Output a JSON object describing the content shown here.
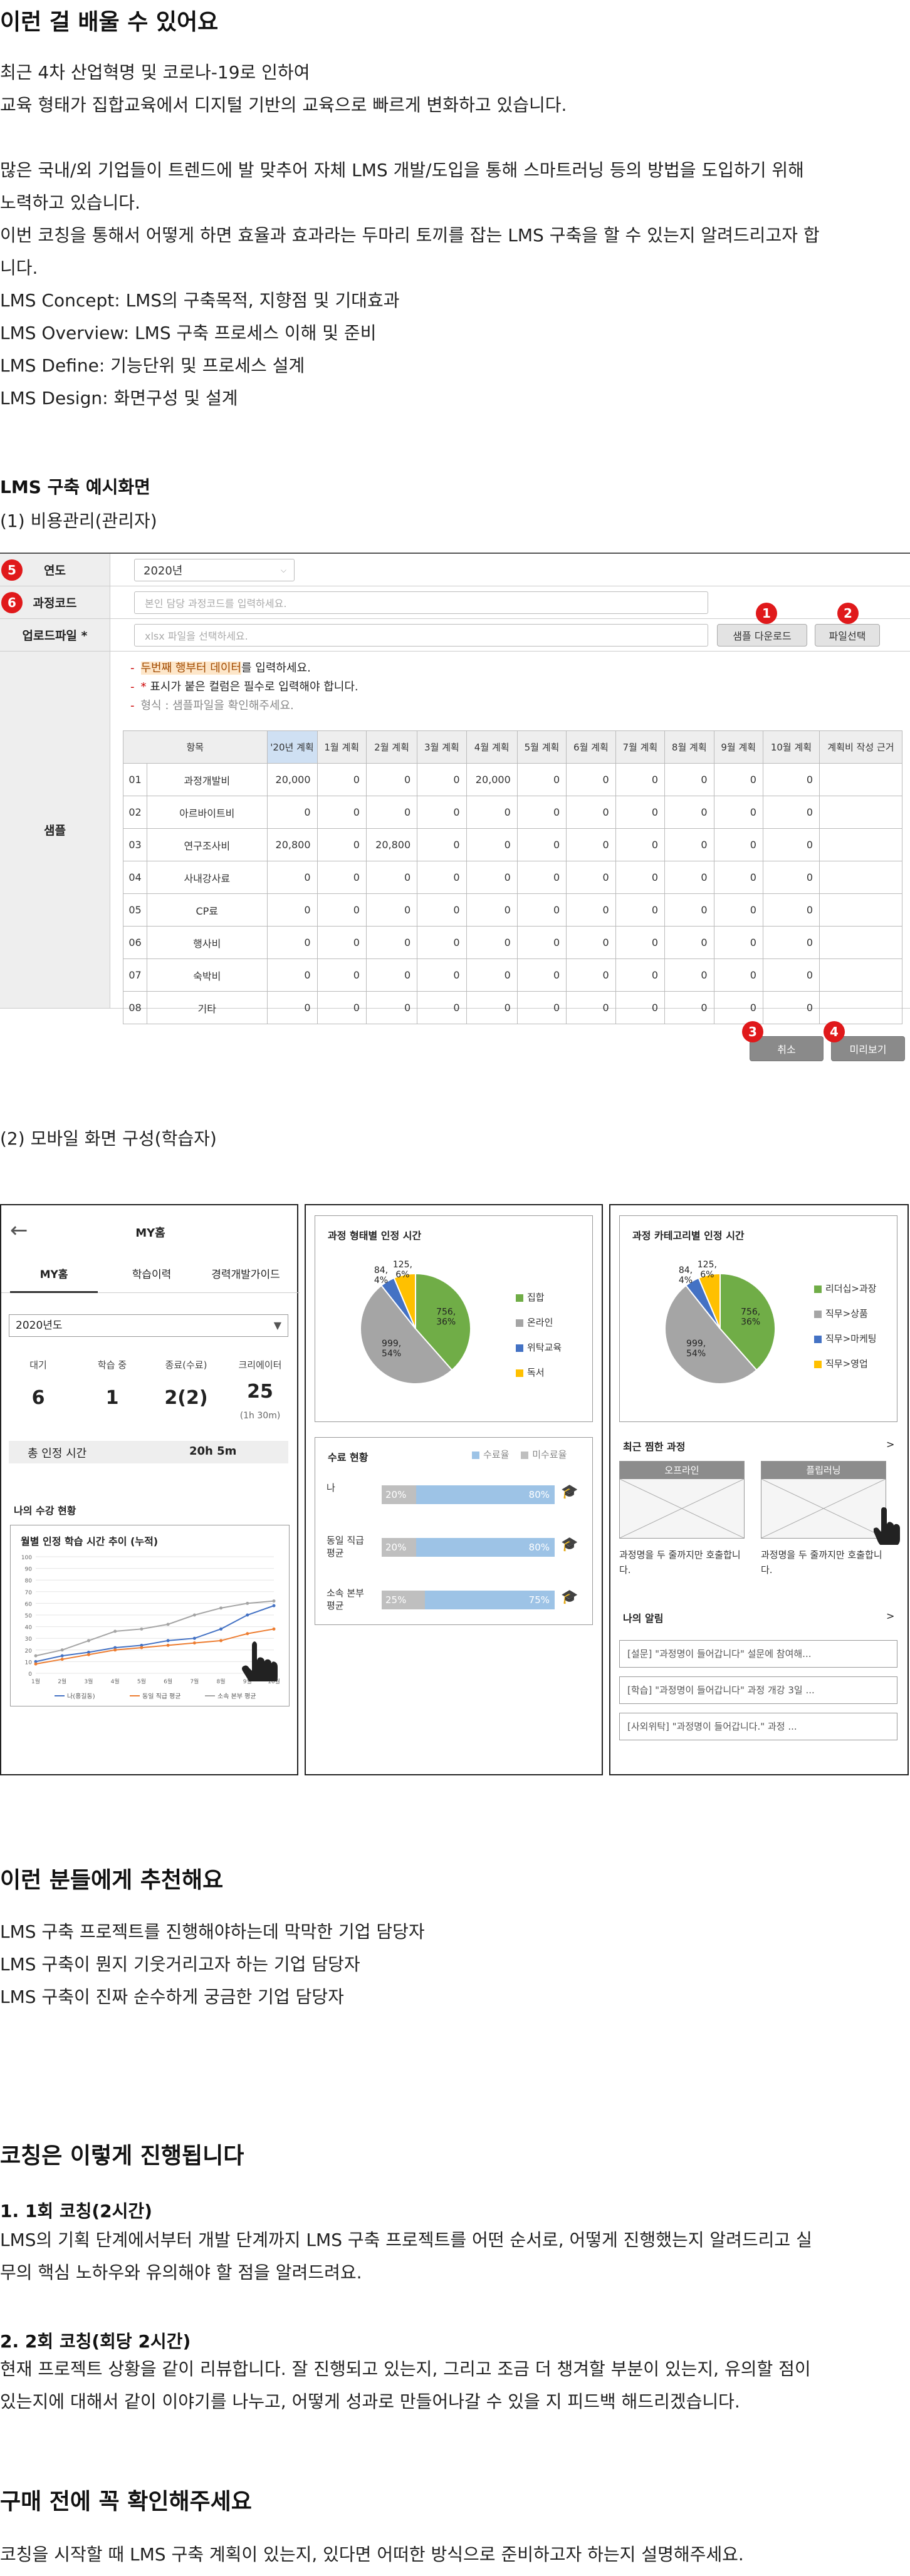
{
  "section1": {
    "title": "이런 걸 배울 수 있어요",
    "paragraphs": [
      "최근 4차 산업혁명 및 코로나-19로 인하여",
      "교육 형태가 집합교육에서 디지털 기반의 교육으로 빠르게 변화하고 있습니다.",
      "많은 국내/외 기업들이 트렌드에 발 맞추어 자체 LMS 개발/도입을 통해 스마트러닝 등의 방법을 도입하기 위해",
      "노력하고 있습니다.",
      "이번 코칭을 통해서 어떻게 하면 효율과 효과라는 두마리 토끼를 잡는 LMS 구축을 할 수 있는지 알려드리고자 합",
      "니다.",
      "LMS Concept:  LMS의 구축목적, 지향점 및 기대효과",
      "LMS Overview: LMS 구축 프로세스 이해 및 준비",
      "LMS Define: 기능단위 및 프로세스 설계",
      "LMS Design: 화면구성 및 설계"
    ],
    "example_title": "LMS 구축 예시화면",
    "example_sub1": "(1) 비용관리(관리자)",
    "example_sub2": "(2) 모바일 화면 구성(학습자)"
  },
  "admin": {
    "badges": [
      "5",
      "6",
      "1",
      "2",
      "3",
      "4"
    ],
    "labels": {
      "year": "연도",
      "course_code": "과정코드",
      "upload": "업로드파일 *",
      "sample": "샘플"
    },
    "year_value": "2020년",
    "course_placeholder": "본인 담당 과정코드를 입력하세요.",
    "upload_placeholder": "xlsx 파일을 선택하세요.",
    "download_button": "샘플 다운로드",
    "select_file_button": "파일선택",
    "cancel_button": "취소",
    "preview_button": "미리보기",
    "notes": {
      "line1_hl": "두번째 행부터 데이터",
      "line1_rest": "를 입력하세요.",
      "line2_star": "*",
      "line2_rest": " 표시가 붙은 컬럼은 필수로 입력해야 합니다.",
      "line3": "형식 : 샘플파일을 확인해주세요."
    },
    "table": {
      "headers": [
        "항목",
        "'20년 계획",
        "1월 계획",
        "2월 계획",
        "3월 계획",
        "4월 계획",
        "5월 계획",
        "6월 계획",
        "7월 계획",
        "8월 계획",
        "9월 계획",
        "10월 계획",
        "계획비 작성 근거"
      ],
      "rows": [
        [
          "01",
          "과정개발비",
          "20,000",
          "0",
          "0",
          "0",
          "20,000",
          "0",
          "0",
          "0",
          "0",
          "0",
          "0",
          ""
        ],
        [
          "02",
          "아르바이트비",
          "0",
          "0",
          "0",
          "0",
          "0",
          "0",
          "0",
          "0",
          "0",
          "0",
          "0",
          ""
        ],
        [
          "03",
          "연구조사비",
          "20,800",
          "0",
          "20,800",
          "0",
          "0",
          "0",
          "0",
          "0",
          "0",
          "0",
          "0",
          ""
        ],
        [
          "04",
          "사내강사료",
          "0",
          "0",
          "0",
          "0",
          "0",
          "0",
          "0",
          "0",
          "0",
          "0",
          "0",
          ""
        ],
        [
          "05",
          "CP료",
          "0",
          "0",
          "0",
          "0",
          "0",
          "0",
          "0",
          "0",
          "0",
          "0",
          "0",
          ""
        ],
        [
          "06",
          "행사비",
          "0",
          "0",
          "0",
          "0",
          "0",
          "0",
          "0",
          "0",
          "0",
          "0",
          "0",
          ""
        ],
        [
          "07",
          "숙박비",
          "0",
          "0",
          "0",
          "0",
          "0",
          "0",
          "0",
          "0",
          "0",
          "0",
          "0",
          ""
        ],
        [
          "08",
          "기타",
          "0",
          "0",
          "0",
          "0",
          "0",
          "0",
          "0",
          "0",
          "0",
          "0",
          "0",
          ""
        ]
      ]
    }
  },
  "mobile1": {
    "title": "MY홈",
    "tabs": [
      "MY홈",
      "학습이력",
      "경력개발가이드"
    ],
    "year_select": "2020년도",
    "stats_labels": [
      "대기",
      "학습 중",
      "종료(수료)",
      "크리에이터"
    ],
    "stats_values": [
      "6",
      "1",
      "2(2)",
      "25"
    ],
    "creator_sub": "(1h 30m)",
    "total_label": "총 인정 시간",
    "total_value": "20h 5m",
    "my_status": "나의 수강 현황",
    "chart_title": "월별 인정 학습 시간 추이 (누적)",
    "legend": [
      "나(홍길동)",
      "동일 직급 평균",
      "소속 본부 평균"
    ]
  },
  "mobile2": {
    "pie_title": "과정 형태별 인정 시간",
    "pie_legend": [
      "집합",
      "온라인",
      "위탁교육",
      "독서"
    ],
    "pie_labels": [
      "125, 6%",
      "84, 4%",
      "756, 36%",
      "999, 54%"
    ],
    "completion_title": "수료 현황",
    "completion_legend": [
      "수료율",
      "미수료율"
    ],
    "rows": [
      {
        "label": "나",
        "left": "20%",
        "right": "80%"
      },
      {
        "label": "동일 직급 평균",
        "left": "20%",
        "right": "80%"
      },
      {
        "label": "소속 본부 평균",
        "left": "25%",
        "right": "75%"
      }
    ]
  },
  "mobile3": {
    "pie_title": "과정 카테고리별 인정 시간",
    "pie_legend": [
      "리더십>과장",
      "직무>상품",
      "직무>마케팅",
      "직무>영업"
    ],
    "pie_labels": [
      "125, 6%",
      "756, 36%",
      "84, 4%",
      "999, 54%"
    ],
    "recent_title": "최근 찜한 과정",
    "recent_more": ">",
    "recent_tags": [
      "오프라인",
      "플립러닝"
    ],
    "recent_desc": [
      "과정명을 두 줄까지만 호출합니다.",
      "과정명을 두 줄까지만 호출합니다."
    ],
    "alerts_title": "나의 알림",
    "alerts_more": ">",
    "alerts": [
      "[설문] \"과정명이 들어갑니다\" 설문에 참여해...",
      "[학습] \"과정명이 들어갑니다\" 과정 개강 3일 ...",
      "[사외위탁] \"과정명이 들어갑니다.\" 과정 ..."
    ]
  },
  "chart_data": [
    {
      "type": "pie",
      "title": "과정 형태별 인정 시간",
      "categories": [
        "집합",
        "온라인",
        "위탁교육",
        "독서"
      ],
      "values": [
        756,
        999,
        84,
        125
      ],
      "labels": [
        "756, 36%",
        "999, 54%",
        "84, 4%",
        "125, 6%"
      ],
      "colors": [
        "#70ad47",
        "#a5a5a5",
        "#4472c4",
        "#ffc000"
      ]
    },
    {
      "type": "pie",
      "title": "과정 카테고리별 인정 시간",
      "categories": [
        "리더십>과장",
        "직무>상품",
        "직무>마케팅",
        "직무>영업"
      ],
      "values": [
        756,
        999,
        84,
        125
      ],
      "labels": [
        "756, 36%",
        "999, 54%",
        "84, 4%",
        "125, 6%"
      ],
      "colors": [
        "#70ad47",
        "#a5a5a5",
        "#4472c4",
        "#ffc000"
      ]
    },
    {
      "type": "line",
      "title": "월별 인정 학습 시간 추이 (누적)",
      "categories": [
        "1월",
        "2월",
        "3월",
        "4월",
        "5월",
        "6월",
        "7월",
        "8월",
        "9월",
        "10월"
      ],
      "series": [
        {
          "name": "나(홍길동)",
          "values": [
            10,
            15,
            18,
            22,
            24,
            28,
            30,
            38,
            50,
            58
          ],
          "color": "#4472c4"
        },
        {
          "name": "동일 직급 평균",
          "values": [
            8,
            12,
            16,
            20,
            22,
            24,
            26,
            28,
            34,
            38
          ],
          "color": "#ed7d31"
        },
        {
          "name": "소속 본부 평균",
          "values": [
            15,
            20,
            28,
            36,
            38,
            42,
            50,
            56,
            60,
            62
          ],
          "color": "#a5a5a5"
        }
      ],
      "ylim": [
        0,
        100
      ],
      "yticks": [
        "0",
        "10",
        "20",
        "30",
        "40",
        "50",
        "60",
        "70",
        "80",
        "90",
        "100"
      ]
    }
  ],
  "section2": {
    "title": "이런 분들에게 추천해요",
    "items": [
      "LMS 구축 프로젝트를 진행해야하는데 막막한 기업 담당자",
      "LMS 구축이 뭔지 기웃거리고자 하는 기업 담당자",
      "LMS 구축이 진짜 순수하게 궁금한 기업 담당자"
    ]
  },
  "section3": {
    "title": "코칭은 이렇게 진행됩니다",
    "step1_title": "1. 1회 코칭(2시간)",
    "step1_lines": [
      "LMS의 기획 단계에서부터 개발 단계까지 LMS 구축 프로젝트를 어떤 순서로, 어떻게 진행했는지 알려드리고 실",
      "무의 핵심 노하우와 유의해야 할 점을 알려드려요."
    ],
    "step2_title": "2. 2회 코칭(회당 2시간)",
    "step2_lines": [
      "현재 프로젝트 상황을 같이 리뷰합니다. 잘 진행되고 있는지, 그리고 조금 더 챙겨할 부분이 있는지, 유의할 점이",
      "있는지에 대해서 같이 이야기를 나누고, 어떻게 성과로 만들어나갈 수 있을 지 피드백 해드리겠습니다."
    ]
  },
  "section4": {
    "title": "구매 전에 꼭 확인해주세요",
    "text": "코칭을 시작할 때 LMS 구축 계획이 있는지, 있다면 어떠한 방식으로 준비하고자 하는지 설명해주세요."
  }
}
